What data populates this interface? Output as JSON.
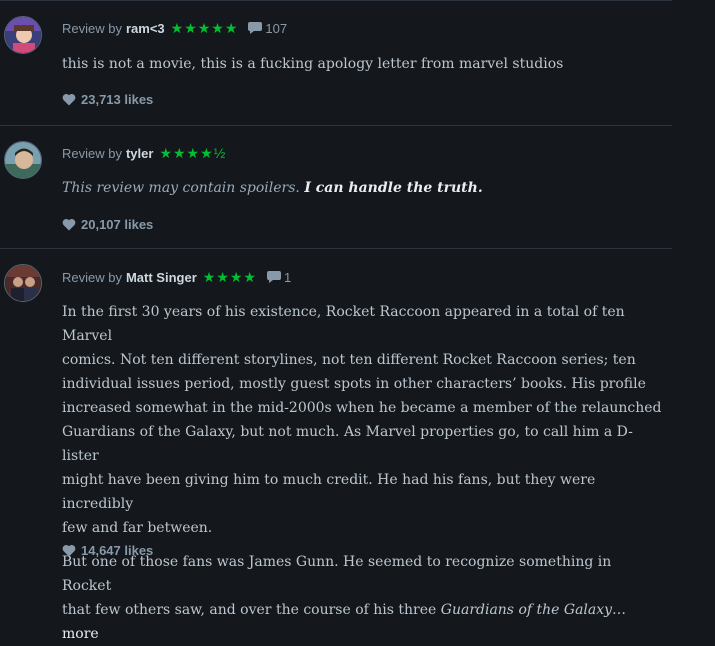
{
  "reviews": [
    {
      "prefix": "Review by",
      "user": "ram<3",
      "stars": "★★★★★",
      "comments": "107",
      "text": "this is not a movie, this is a fucking apology letter from marvel studios",
      "likes": "23,713 likes"
    },
    {
      "prefix": "Review by",
      "user": "tyler",
      "stars": "★★★★½",
      "spoiler_notice": "This review may contain spoilers.",
      "spoiler_link": "I can handle the truth.",
      "likes": "20,107 likes"
    },
    {
      "prefix": "Review by",
      "user": "Matt Singer",
      "stars": "★★★★",
      "comments": "1",
      "paragraph1_lines": [
        "In the first 30 years of his existence, Rocket Raccoon appeared in a total of ten Marvel",
        "comics. Not ten different storylines, not ten different Rocket Raccoon series; ten",
        "individual issues period, mostly guest spots in other characters’ books. His profile",
        "increased somewhat in the mid-2000s when he became a member of the relaunched",
        "Guardians of the Galaxy, but not much. As Marvel properties go, to call him a D-lister",
        "might have been giving him to much credit. He had his fans, but they were incredibly",
        "few and far between."
      ],
      "paragraph2_line1": "But one of those fans was James Gunn. He seemed to recognize something in Rocket",
      "paragraph2_line2_start": "that few others saw, and over the course of his three ",
      "paragraph2_italic": "Guardians of the Galaxy",
      "paragraph2_ellipsis": "… ",
      "more_label": "more",
      "likes": "14,647 likes"
    }
  ],
  "icons": {
    "comment": "speech-bubble-icon",
    "like": "heart-icon"
  },
  "colors": {
    "background": "#14181c",
    "stars": "#00c030",
    "separator": "#2c3440"
  }
}
